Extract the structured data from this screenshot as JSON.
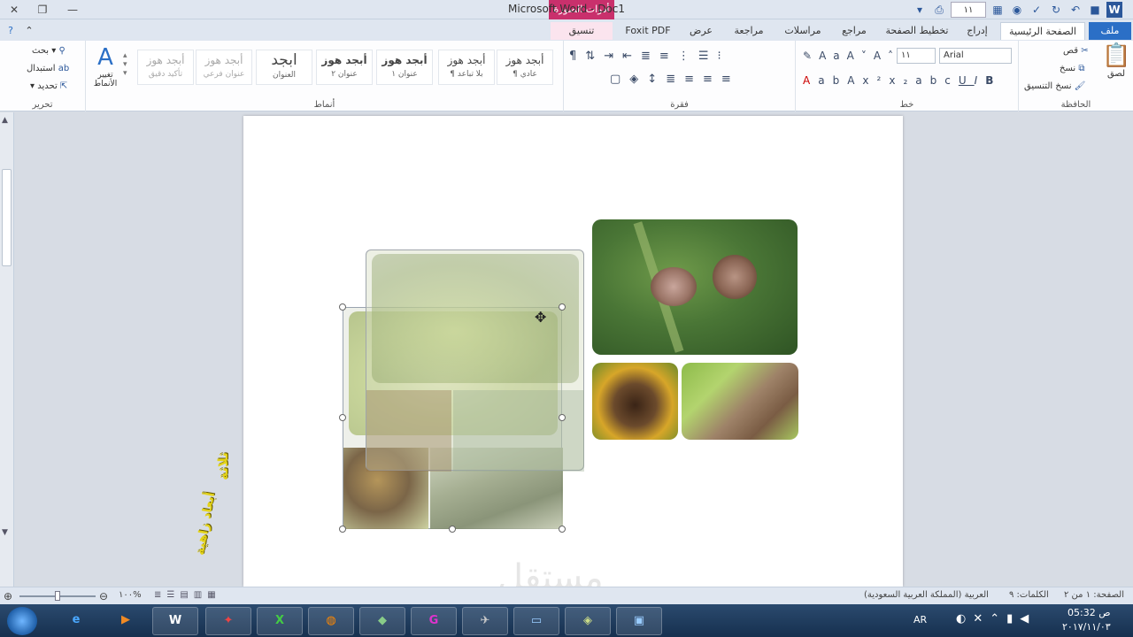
{
  "window": {
    "title": "Microsoft Word - Doc1",
    "context_tab_header": "أدوات الصورة",
    "zoom_combo": "١١"
  },
  "tabs": {
    "file": "ملف",
    "home": "الصفحة الرئيسية",
    "insert": "إدراج",
    "layout": "تخطيط الصفحة",
    "references": "مراجع",
    "mailings": "مراسلات",
    "review": "مراجعة",
    "view": "عرض",
    "foxit": "Foxit PDF",
    "format": "تنسيق"
  },
  "ribbon": {
    "clipboard": {
      "label": "الحافظة",
      "paste": "لصق",
      "cut": "قص",
      "copy": "نسخ",
      "format_painter": "نسخ التنسيق"
    },
    "font": {
      "label": "خط",
      "font_name": "Arial",
      "font_size": "١١"
    },
    "paragraph": {
      "label": "فقرة"
    },
    "styles": {
      "label": "أنماط",
      "change_styles": "تغيير الأنماط",
      "items": [
        {
          "sample": "أبجد هوز",
          "name": "¶ عادي"
        },
        {
          "sample": "أبجد هوز",
          "name": "¶ بلا تباعد"
        },
        {
          "sample": "أبجد هوز",
          "name": "عنوان ١"
        },
        {
          "sample": "أبجد هوز",
          "name": "عنوان ٢"
        },
        {
          "sample": "ابجد",
          "name": "العنوان"
        },
        {
          "sample": "أبجد هوز",
          "name": "عنوان فرعي"
        },
        {
          "sample": "أبجد هوز",
          "name": "تأكيد دقيق"
        }
      ]
    },
    "editing": {
      "label": "تحرير",
      "find": "بحث",
      "replace": "استبدال",
      "select": "تحديد"
    }
  },
  "document": {
    "watermark": "مستقل",
    "side_text_top": "ثلاثة",
    "side_text_bottom": "أبعاد زاهية"
  },
  "statusbar": {
    "page": "الصفحة: ١ من ٢",
    "words": "الكلمات: ٩",
    "language": "العربية (المملكة العربية السعودية)",
    "zoom": "١٠٠%"
  },
  "taskbar": {
    "lang": "AR",
    "time": "05:32 ص",
    "date": "٢٠١٧/١١/٠٣"
  },
  "colors": {
    "file_tab": "#2b6fc6",
    "context_tab": "#c9306c",
    "leaf_green": "#3f6b34",
    "blight_brown": "#8a6a52"
  }
}
